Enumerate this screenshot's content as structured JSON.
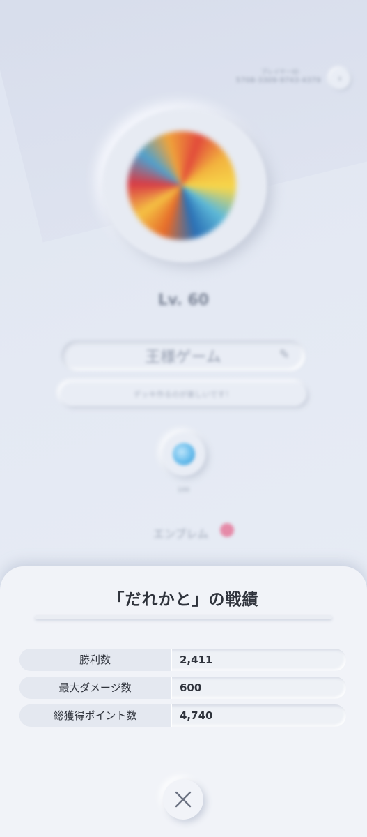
{
  "profile": {
    "player_id_label": "プレイヤーID",
    "player_id": "5708-3309-9743-4379",
    "level": "Lv. 60",
    "name": "王様ゲーム",
    "bio": "デッキ作るのが楽しいです！",
    "badge_label": "100",
    "emblem_label": "エンブレム"
  },
  "sheet": {
    "title": "「だれかと」の戦績",
    "stats": [
      {
        "label": "勝利数",
        "value": "2,411"
      },
      {
        "label": "最大ダメージ数",
        "value": "600"
      },
      {
        "label": "総獲得ポイント数",
        "value": "4,740"
      }
    ]
  },
  "icons": {
    "close": "close-icon",
    "edit": "pencil-icon",
    "copy": "copy-icon"
  }
}
